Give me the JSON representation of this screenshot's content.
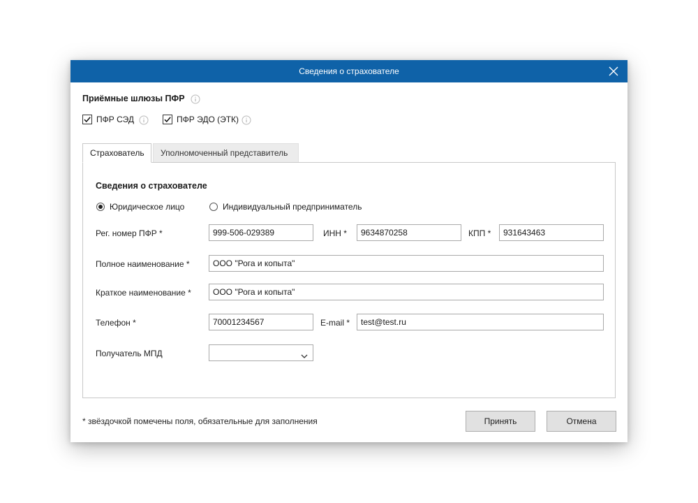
{
  "dialog": {
    "title": "Сведения о страхователе"
  },
  "gateways": {
    "heading": "Приёмные шлюзы ПФР",
    "items": [
      {
        "label": "ПФР СЭД",
        "checked": true
      },
      {
        "label": "ПФР ЭДО (ЭТК)",
        "checked": true
      }
    ]
  },
  "tabs": [
    {
      "label": "Страхователь",
      "active": true
    },
    {
      "label": "Уполномоченный представитель",
      "active": false
    }
  ],
  "form": {
    "heading": "Сведения о страхователе",
    "entity_type": {
      "options": [
        "Юридическое лицо",
        "Индивидуальный предприниматель"
      ],
      "selected": "Юридическое лицо"
    },
    "reg_number": {
      "label": "Рег. номер ПФР *",
      "value": "999-506-029389"
    },
    "inn": {
      "label": "ИНН *",
      "value": "9634870258"
    },
    "kpp": {
      "label": "КПП *",
      "value": "931643463"
    },
    "full_name": {
      "label": "Полное наименование *",
      "value": "ООО \"Рога и копыта\""
    },
    "short_name": {
      "label": "Краткое наименование *",
      "value": "ООО \"Рога и копыта\""
    },
    "phone": {
      "label": "Телефон *",
      "value": "70001234567"
    },
    "email": {
      "label": "E-mail *",
      "value": "test@test.ru"
    },
    "mpd_recipient": {
      "label": "Получатель МПД",
      "value": ""
    }
  },
  "footer": {
    "note": "* звёздочкой помечены поля, обязательные для заполнения",
    "accept_label": "Принять",
    "cancel_label": "Отмена"
  },
  "colors": {
    "titlebar": "#0f62a8",
    "button_bg": "#e1e1e1"
  },
  "icons": {
    "close": "close-icon",
    "info": "info-icon",
    "check": "check-icon",
    "chevron": "chevron-down-icon"
  }
}
